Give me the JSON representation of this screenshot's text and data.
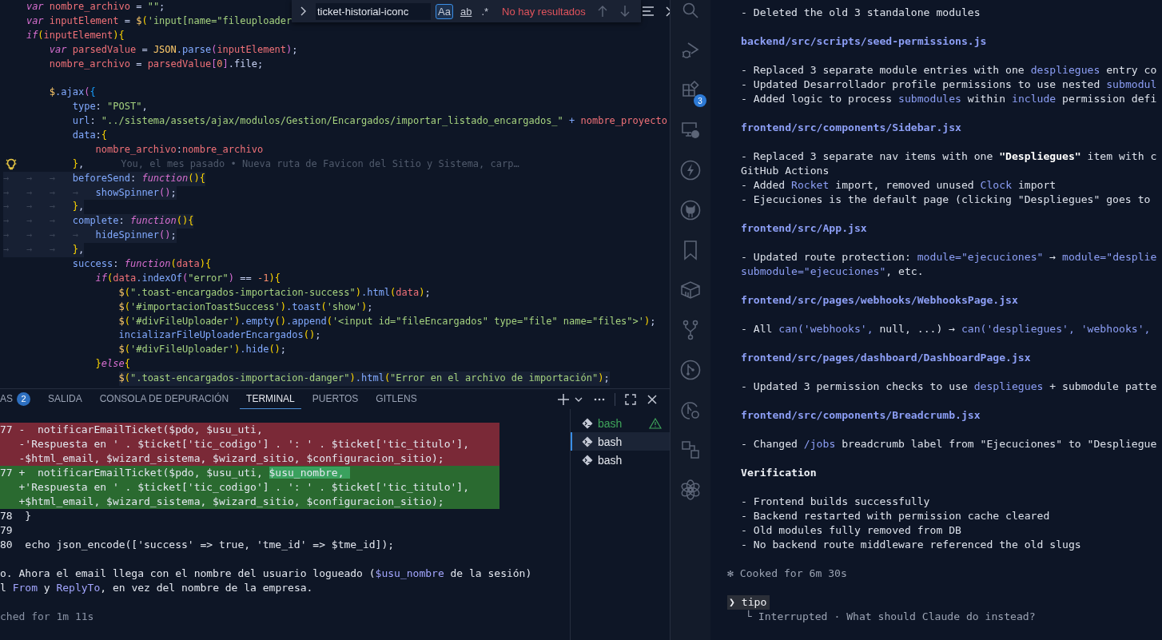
{
  "editor": {
    "lines": [
      {
        "kind": "code",
        "tokens": [
          {
            "text": "    var",
            "kind": "kw"
          },
          {
            "text": " nombre_archivo",
            "kind": "id"
          },
          {
            "text": " = ",
            "kind": "punc"
          },
          {
            "text": "\"\"",
            "kind": "str"
          },
          {
            "text": ";",
            "kind": "punc"
          }
        ]
      },
      {
        "kind": "code",
        "tokens": [
          {
            "text": "    var",
            "kind": "kw"
          },
          {
            "text": " inputElement",
            "kind": "id"
          },
          {
            "text": " = ",
            "kind": "punc"
          },
          {
            "text": "$",
            "kind": "obj"
          },
          {
            "text": "(",
            "kind": "brace"
          },
          {
            "text": "'input[name=\"fileuploader",
            "kind": "str"
          }
        ]
      },
      {
        "kind": "code",
        "tokens": [
          {
            "text": "    if",
            "kind": "kw"
          },
          {
            "text": "(",
            "kind": "brace"
          },
          {
            "text": "inputElement",
            "kind": "id"
          },
          {
            "text": ")",
            "kind": "brace"
          },
          {
            "text": "{",
            "kind": "brace"
          }
        ]
      },
      {
        "kind": "code",
        "tokens": [
          {
            "text": "        var",
            "kind": "kw"
          },
          {
            "text": " parsedValue",
            "kind": "id"
          },
          {
            "text": " = ",
            "kind": "punc"
          },
          {
            "text": "JSON",
            "kind": "obj"
          },
          {
            "text": ".parse",
            "kind": "member"
          },
          {
            "text": "(",
            "kind": "brace2"
          },
          {
            "text": "inputElement",
            "kind": "id"
          },
          {
            "text": ")",
            "kind": "brace2"
          },
          {
            "text": ";",
            "kind": "punc"
          }
        ]
      },
      {
        "kind": "code",
        "tokens": [
          {
            "text": "        nombre_archivo",
            "kind": "id"
          },
          {
            "text": " = ",
            "kind": "punc"
          },
          {
            "text": "parsedValue",
            "kind": "id"
          },
          {
            "text": "[",
            "kind": "brace2"
          },
          {
            "text": "0",
            "kind": "num"
          },
          {
            "text": "]",
            "kind": "brace2"
          },
          {
            "text": ".file;",
            "kind": "punc"
          }
        ]
      },
      {
        "kind": "blank"
      },
      {
        "kind": "code",
        "tokens": [
          {
            "text": "        $",
            "kind": "obj"
          },
          {
            "text": ".ajax",
            "kind": "member"
          },
          {
            "text": "(",
            "kind": "brace2"
          },
          {
            "text": "{",
            "kind": "brace3"
          }
        ]
      },
      {
        "kind": "code",
        "tokens": [
          {
            "text": "            type",
            "kind": "member"
          },
          {
            "text": ": ",
            "kind": "punc"
          },
          {
            "text": "\"POST\"",
            "kind": "str"
          },
          {
            "text": ",",
            "kind": "punc"
          }
        ]
      },
      {
        "kind": "code",
        "tokens": [
          {
            "text": "            url",
            "kind": "member"
          },
          {
            "text": ": ",
            "kind": "punc"
          },
          {
            "text": "\"../sistema/assets/ajax/modulos/Gestion/Encargados/importar_listado_encargados_\"",
            "kind": "str"
          },
          {
            "text": " + ",
            "kind": "member"
          },
          {
            "text": "nombre_proyecto",
            "kind": "id"
          }
        ]
      },
      {
        "kind": "code",
        "tokens": [
          {
            "text": "            data",
            "kind": "member"
          },
          {
            "text": ":",
            "kind": "punc"
          },
          {
            "text": "{",
            "kind": "brace"
          }
        ]
      },
      {
        "kind": "code",
        "tokens": [
          {
            "text": "                nombre_archivo",
            "kind": "id"
          },
          {
            "text": ":",
            "kind": "punc"
          },
          {
            "text": "nombre_archivo",
            "kind": "id"
          }
        ]
      },
      {
        "kind": "code",
        "lightbulb": true,
        "blame": "You, el mes pasado • Nueva ruta de Favicon del Sitio y Sistema, carp…",
        "tokens": [
          {
            "text": "            }",
            "kind": "brace"
          },
          {
            "text": ",",
            "kind": "punc"
          }
        ]
      },
      {
        "kind": "code",
        "highlighted": true,
        "tokens": [
          {
            "text": "→   →   →   ",
            "kind": "ws"
          },
          {
            "text": "beforeSend",
            "kind": "member"
          },
          {
            "text": ": ",
            "kind": "punc"
          },
          {
            "text": "function",
            "kind": "kw"
          },
          {
            "text": "()",
            "kind": "brace"
          },
          {
            "text": "{",
            "kind": "brace"
          }
        ]
      },
      {
        "kind": "code",
        "highlighted": true,
        "tokens": [
          {
            "text": "→   →   →   →   ",
            "kind": "ws"
          },
          {
            "text": "showSpinner",
            "kind": "member"
          },
          {
            "text": "()",
            "kind": "brace2"
          },
          {
            "text": ";",
            "kind": "punc"
          }
        ]
      },
      {
        "kind": "code",
        "highlighted": true,
        "tokens": [
          {
            "text": "→   →   →   ",
            "kind": "ws"
          },
          {
            "text": "}",
            "kind": "brace"
          },
          {
            "text": ",",
            "kind": "punc"
          }
        ]
      },
      {
        "kind": "code",
        "highlighted": true,
        "tokens": [
          {
            "text": "→   →   →   ",
            "kind": "ws"
          },
          {
            "text": "complete",
            "kind": "member"
          },
          {
            "text": ": ",
            "kind": "punc"
          },
          {
            "text": "function",
            "kind": "kw"
          },
          {
            "text": "()",
            "kind": "brace"
          },
          {
            "text": "{",
            "kind": "brace"
          }
        ]
      },
      {
        "kind": "code",
        "highlighted": true,
        "tokens": [
          {
            "text": "→   →   →   →   ",
            "kind": "ws"
          },
          {
            "text": "hideSpinner",
            "kind": "member"
          },
          {
            "text": "()",
            "kind": "brace2"
          },
          {
            "text": ";",
            "kind": "punc"
          }
        ]
      },
      {
        "kind": "code",
        "highlighted": true,
        "tokens": [
          {
            "text": "→   →   →   ",
            "kind": "ws"
          },
          {
            "text": "}",
            "kind": "brace"
          },
          {
            "text": ",",
            "kind": "punc"
          }
        ]
      },
      {
        "kind": "code",
        "tokens": [
          {
            "text": "            success",
            "kind": "member"
          },
          {
            "text": ": ",
            "kind": "punc"
          },
          {
            "text": "function",
            "kind": "kw"
          },
          {
            "text": "(",
            "kind": "brace"
          },
          {
            "text": "data",
            "kind": "id"
          },
          {
            "text": ")",
            "kind": "brace"
          },
          {
            "text": "{",
            "kind": "brace"
          }
        ]
      },
      {
        "kind": "code",
        "tokens": [
          {
            "text": "                if",
            "kind": "kw"
          },
          {
            "text": "(",
            "kind": "brace"
          },
          {
            "text": "data",
            "kind": "id"
          },
          {
            "text": ".indexOf",
            "kind": "member"
          },
          {
            "text": "(",
            "kind": "brace2"
          },
          {
            "text": "\"error\"",
            "kind": "str"
          },
          {
            "text": ")",
            "kind": "brace2"
          },
          {
            "text": " == ",
            "kind": "punc"
          },
          {
            "text": "-1",
            "kind": "num"
          },
          {
            "text": ")",
            "kind": "brace"
          },
          {
            "text": "{",
            "kind": "brace"
          }
        ]
      },
      {
        "kind": "code",
        "tokens": [
          {
            "text": "                    $",
            "kind": "obj"
          },
          {
            "text": "(",
            "kind": "brace"
          },
          {
            "text": "\".toast-encargados-importacion-success\"",
            "kind": "str"
          },
          {
            "text": ")",
            "kind": "brace"
          },
          {
            "text": ".html",
            "kind": "member"
          },
          {
            "text": "(",
            "kind": "brace"
          },
          {
            "text": "data",
            "kind": "id"
          },
          {
            "text": ")",
            "kind": "brace"
          },
          {
            "text": ";",
            "kind": "punc"
          }
        ]
      },
      {
        "kind": "code",
        "tokens": [
          {
            "text": "                    $",
            "kind": "obj"
          },
          {
            "text": "(",
            "kind": "brace"
          },
          {
            "text": "'#importacionToastSuccess'",
            "kind": "str"
          },
          {
            "text": ")",
            "kind": "brace"
          },
          {
            "text": ".toast",
            "kind": "member"
          },
          {
            "text": "(",
            "kind": "brace"
          },
          {
            "text": "'show'",
            "kind": "str"
          },
          {
            "text": ")",
            "kind": "brace"
          },
          {
            "text": ";",
            "kind": "punc"
          }
        ]
      },
      {
        "kind": "code",
        "tokens": [
          {
            "text": "                    $",
            "kind": "obj"
          },
          {
            "text": "(",
            "kind": "brace"
          },
          {
            "text": "'#divFileUploader'",
            "kind": "str"
          },
          {
            "text": ")",
            "kind": "brace"
          },
          {
            "text": ".empty",
            "kind": "member"
          },
          {
            "text": "()",
            "kind": "brace"
          },
          {
            "text": ".append",
            "kind": "member"
          },
          {
            "text": "(",
            "kind": "brace"
          },
          {
            "text": "'<input id=\"fileEncargados\" type=\"file\" name=\"files\">'",
            "kind": "str"
          },
          {
            "text": ")",
            "kind": "brace"
          },
          {
            "text": ";",
            "kind": "punc"
          }
        ]
      },
      {
        "kind": "code",
        "tokens": [
          {
            "text": "                    incializarFileUploaderEncargados",
            "kind": "member"
          },
          {
            "text": "()",
            "kind": "brace"
          },
          {
            "text": ";",
            "kind": "punc"
          }
        ]
      },
      {
        "kind": "code",
        "tokens": [
          {
            "text": "                    $",
            "kind": "obj"
          },
          {
            "text": "(",
            "kind": "brace"
          },
          {
            "text": "'#divFileUploader'",
            "kind": "str"
          },
          {
            "text": ")",
            "kind": "brace"
          },
          {
            "text": ".hide",
            "kind": "member"
          },
          {
            "text": "()",
            "kind": "brace"
          },
          {
            "text": ";",
            "kind": "punc"
          }
        ]
      },
      {
        "kind": "code",
        "tokens": [
          {
            "text": "                }",
            "kind": "brace"
          },
          {
            "text": "else",
            "kind": "kw"
          },
          {
            "text": "{",
            "kind": "brace"
          }
        ]
      },
      {
        "kind": "code",
        "highlighted": true,
        "tokens": [
          {
            "text": "                    $",
            "kind": "obj"
          },
          {
            "text": "(",
            "kind": "brace"
          },
          {
            "text": "\".toast-encargados-importacion-danger\"",
            "kind": "str"
          },
          {
            "text": ")",
            "kind": "brace"
          },
          {
            "text": ".html",
            "kind": "member"
          },
          {
            "text": "(",
            "kind": "brace"
          },
          {
            "text": "\"Error en el archivo de importación\"",
            "kind": "str"
          },
          {
            "text": ")",
            "kind": "brace"
          },
          {
            "text": ";",
            "kind": "punc"
          }
        ]
      }
    ]
  },
  "find_widget": {
    "query": "ticket-historial-iconc",
    "toggles": [
      {
        "label": "Aa",
        "on": true
      },
      {
        "label": "ab",
        "on": false
      },
      {
        "label": ".*",
        "on": false
      }
    ],
    "result": "No hay resultados"
  },
  "panel": {
    "tabs": [
      {
        "label": "AS",
        "badge": "2",
        "selected": false
      },
      {
        "label": "SALIDA",
        "selected": false
      },
      {
        "label": "CONSOLA DE DEPURACIÓN",
        "selected": false
      },
      {
        "label": "TERMINAL",
        "selected": true
      },
      {
        "label": "PUERTOS",
        "selected": false
      },
      {
        "label": "GITLENS",
        "selected": false
      }
    ],
    "terminal_lines": [
      {
        "kind": "removed",
        "segments": [
          {
            "text": "77 -  notificarEmailTicket($pdo, $usu_uti,",
            "kind": "plain"
          }
        ]
      },
      {
        "kind": "removed",
        "segments": [
          {
            "text": "   -'Respuesta en ' . $ticket['tic_codigo'] . ': ' . $ticket['tic_titulo'],",
            "kind": "plain"
          }
        ]
      },
      {
        "kind": "removed",
        "segments": [
          {
            "text": "   -$html_email, $wizard_sistema, $wizard_sitio, $configuracion_sitio);",
            "kind": "plain"
          }
        ]
      },
      {
        "kind": "added",
        "segments": [
          {
            "text": "77 +  notificarEmailTicket($pdo, $usu_uti, ",
            "kind": "plain"
          },
          {
            "text": "$usu_nombre, ",
            "kind": "match"
          }
        ]
      },
      {
        "kind": "added",
        "segments": [
          {
            "text": "   +'Respuesta en ' . $ticket['tic_codigo'] . ': ' . $ticket['tic_titulo'],",
            "kind": "plain"
          }
        ]
      },
      {
        "kind": "added",
        "segments": [
          {
            "text": "   +$html_email, $wizard_sistema, $wizard_sitio, $configuracion_sitio);",
            "kind": "plain"
          }
        ]
      },
      {
        "kind": "plain",
        "segments": [
          {
            "text": "78  }",
            "kind": "plain"
          }
        ]
      },
      {
        "kind": "plain",
        "segments": [
          {
            "text": "79",
            "kind": "plain"
          }
        ]
      },
      {
        "kind": "plain",
        "segments": [
          {
            "text": "80  echo json_encode(['success' => true, 'tme_id' => $tme_id]);",
            "kind": "plain"
          }
        ]
      },
      {
        "kind": "blank"
      },
      {
        "kind": "plain",
        "segments": [
          {
            "text": "o. Ahora el email llega con el nombre del usuario logueado (",
            "kind": "plain"
          },
          {
            "text": "$usu_nombre",
            "kind": "code"
          },
          {
            "text": " de la sesión)",
            "kind": "plain"
          }
        ]
      },
      {
        "kind": "plain",
        "segments": [
          {
            "text": "l ",
            "kind": "plain"
          },
          {
            "text": "From",
            "kind": "code"
          },
          {
            "text": " y ",
            "kind": "plain"
          },
          {
            "text": "ReplyTo",
            "kind": "code"
          },
          {
            "text": ", en vez del nombre de la empresa.",
            "kind": "plain"
          }
        ]
      },
      {
        "kind": "blank"
      },
      {
        "kind": "plain",
        "segments": [
          {
            "text": "ched for 1m 11s",
            "kind": "dim"
          }
        ]
      }
    ],
    "terminals": [
      {
        "label": "bash",
        "selected": false,
        "warning": true
      },
      {
        "label": "bash",
        "selected": true,
        "warning": false
      },
      {
        "label": "bash",
        "selected": false,
        "warning": false
      }
    ]
  },
  "activity_bar": [
    {
      "kind": "search"
    },
    {
      "kind": "run"
    },
    {
      "kind": "extensions",
      "badge": "3"
    },
    {
      "kind": "remote"
    },
    {
      "kind": "lightning"
    },
    {
      "kind": "github"
    },
    {
      "kind": "bookmark"
    },
    {
      "kind": "package"
    },
    {
      "kind": "branch"
    },
    {
      "kind": "pull"
    },
    {
      "kind": "graph"
    },
    {
      "kind": "diagram"
    },
    {
      "kind": "knot"
    }
  ],
  "chat": {
    "lines": [
      {
        "kind": "text",
        "segments": [
          {
            "text": "- Deleted the old 3 standalone modules",
            "kind": "plain"
          }
        ]
      },
      {
        "kind": "blank"
      },
      {
        "kind": "heading",
        "text": "backend/src/scripts/seed-permissions.js"
      },
      {
        "kind": "blank"
      },
      {
        "kind": "text",
        "segments": [
          {
            "text": "- Replaced 3 separate module entries with one ",
            "kind": "plain"
          },
          {
            "text": "despliegues",
            "kind": "code"
          },
          {
            "text": " entry co",
            "kind": "plain"
          }
        ]
      },
      {
        "kind": "text",
        "segments": [
          {
            "text": "- Updated Desarrollador profile permissions to use nested ",
            "kind": "plain"
          },
          {
            "text": "submodul",
            "kind": "code"
          }
        ]
      },
      {
        "kind": "text",
        "segments": [
          {
            "text": "- Added logic to process ",
            "kind": "plain"
          },
          {
            "text": "submodules",
            "kind": "code"
          },
          {
            "text": " within ",
            "kind": "plain"
          },
          {
            "text": "include",
            "kind": "code"
          },
          {
            "text": " permission defi",
            "kind": "plain"
          }
        ]
      },
      {
        "kind": "blank"
      },
      {
        "kind": "heading",
        "text": "frontend/src/components/Sidebar.jsx"
      },
      {
        "kind": "blank"
      },
      {
        "kind": "text",
        "segments": [
          {
            "text": "- Replaced 3 separate nav items with one ",
            "kind": "plain"
          },
          {
            "text": "\"Despliegues\"",
            "kind": "bold"
          },
          {
            "text": " item with c",
            "kind": "plain"
          }
        ]
      },
      {
        "kind": "text",
        "segments": [
          {
            "text": "GitHub Actions",
            "kind": "plain"
          }
        ]
      },
      {
        "kind": "text",
        "segments": [
          {
            "text": "- Added ",
            "kind": "plain"
          },
          {
            "text": "Rocket",
            "kind": "code"
          },
          {
            "text": " import, removed unused ",
            "kind": "plain"
          },
          {
            "text": "Clock",
            "kind": "code"
          },
          {
            "text": " import",
            "kind": "plain"
          }
        ]
      },
      {
        "kind": "text",
        "segments": [
          {
            "text": "- Ejecuciones is the default page (clicking \"Despliegues\" goes to",
            "kind": "plain"
          }
        ]
      },
      {
        "kind": "blank"
      },
      {
        "kind": "heading",
        "text": "frontend/src/App.jsx"
      },
      {
        "kind": "blank"
      },
      {
        "kind": "text",
        "segments": [
          {
            "text": "- Updated route protection: ",
            "kind": "plain"
          },
          {
            "text": "module=\"ejecuciones\"",
            "kind": "code"
          },
          {
            "text": " → ",
            "kind": "plain"
          },
          {
            "text": "module=\"desplie",
            "kind": "code"
          }
        ]
      },
      {
        "kind": "text",
        "segments": [
          {
            "text": "submodule=\"ejecuciones\"",
            "kind": "code"
          },
          {
            "text": ", etc.",
            "kind": "plain"
          }
        ]
      },
      {
        "kind": "blank"
      },
      {
        "kind": "heading",
        "text": "frontend/src/pages/webhooks/WebhooksPage.jsx"
      },
      {
        "kind": "blank"
      },
      {
        "kind": "text",
        "segments": [
          {
            "text": "- All ",
            "kind": "plain"
          },
          {
            "text": "can('webhooks',",
            "kind": "code"
          },
          {
            "text": " null, ...) → ",
            "kind": "plain"
          },
          {
            "text": "can('despliegues', 'webhooks',",
            "kind": "code"
          }
        ]
      },
      {
        "kind": "blank"
      },
      {
        "kind": "heading",
        "text": "frontend/src/pages/dashboard/DashboardPage.jsx"
      },
      {
        "kind": "blank"
      },
      {
        "kind": "text",
        "segments": [
          {
            "text": "- Updated 3 permission checks to use ",
            "kind": "plain"
          },
          {
            "text": "despliegues",
            "kind": "code"
          },
          {
            "text": " + submodule patte",
            "kind": "plain"
          }
        ]
      },
      {
        "kind": "blank"
      },
      {
        "kind": "heading",
        "text": "frontend/src/components/Breadcrumb.jsx"
      },
      {
        "kind": "blank"
      },
      {
        "kind": "text",
        "segments": [
          {
            "text": "- Changed ",
            "kind": "plain"
          },
          {
            "text": "/jobs",
            "kind": "code"
          },
          {
            "text": " breadcrumb label from \"Ejecuciones\" to \"Despliegue",
            "kind": "plain"
          }
        ]
      },
      {
        "kind": "blank"
      },
      {
        "kind": "section",
        "text": "Verification"
      },
      {
        "kind": "blank"
      },
      {
        "kind": "text",
        "segments": [
          {
            "text": "- Frontend builds successfully",
            "kind": "plain"
          }
        ]
      },
      {
        "kind": "text",
        "segments": [
          {
            "text": "- Backend restarted with permission cache cleared",
            "kind": "plain"
          }
        ]
      },
      {
        "kind": "text",
        "segments": [
          {
            "text": "- Old modules fully removed from DB",
            "kind": "plain"
          }
        ]
      },
      {
        "kind": "text",
        "segments": [
          {
            "text": "- No backend route middleware referenced the old slugs",
            "kind": "plain"
          }
        ]
      }
    ],
    "status": {
      "icon": "✻",
      "text": "Cooked for 6m 30s"
    },
    "prompt": {
      "marker": "❯",
      "text": "tipo"
    },
    "reply": {
      "marker": "└",
      "text": "Interrupted · What should Claude do instead?"
    }
  }
}
